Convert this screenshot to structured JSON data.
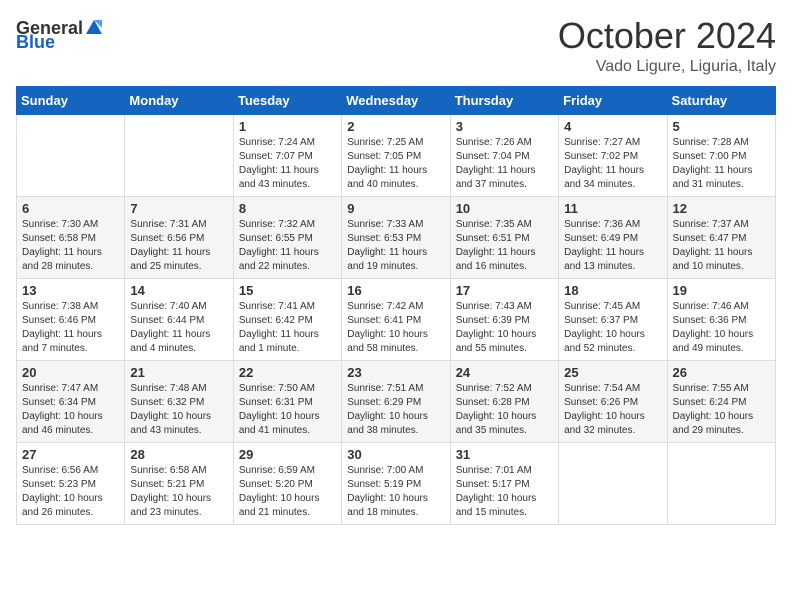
{
  "header": {
    "logo_general": "General",
    "logo_blue": "Blue",
    "month": "October 2024",
    "location": "Vado Ligure, Liguria, Italy"
  },
  "days_of_week": [
    "Sunday",
    "Monday",
    "Tuesday",
    "Wednesday",
    "Thursday",
    "Friday",
    "Saturday"
  ],
  "weeks": [
    [
      null,
      null,
      {
        "day": 1,
        "sunrise": "7:24 AM",
        "sunset": "7:07 PM",
        "daylight": "11 hours and 43 minutes."
      },
      {
        "day": 2,
        "sunrise": "7:25 AM",
        "sunset": "7:05 PM",
        "daylight": "11 hours and 40 minutes."
      },
      {
        "day": 3,
        "sunrise": "7:26 AM",
        "sunset": "7:04 PM",
        "daylight": "11 hours and 37 minutes."
      },
      {
        "day": 4,
        "sunrise": "7:27 AM",
        "sunset": "7:02 PM",
        "daylight": "11 hours and 34 minutes."
      },
      {
        "day": 5,
        "sunrise": "7:28 AM",
        "sunset": "7:00 PM",
        "daylight": "11 hours and 31 minutes."
      }
    ],
    [
      {
        "day": 6,
        "sunrise": "7:30 AM",
        "sunset": "6:58 PM",
        "daylight": "11 hours and 28 minutes."
      },
      {
        "day": 7,
        "sunrise": "7:31 AM",
        "sunset": "6:56 PM",
        "daylight": "11 hours and 25 minutes."
      },
      {
        "day": 8,
        "sunrise": "7:32 AM",
        "sunset": "6:55 PM",
        "daylight": "11 hours and 22 minutes."
      },
      {
        "day": 9,
        "sunrise": "7:33 AM",
        "sunset": "6:53 PM",
        "daylight": "11 hours and 19 minutes."
      },
      {
        "day": 10,
        "sunrise": "7:35 AM",
        "sunset": "6:51 PM",
        "daylight": "11 hours and 16 minutes."
      },
      {
        "day": 11,
        "sunrise": "7:36 AM",
        "sunset": "6:49 PM",
        "daylight": "11 hours and 13 minutes."
      },
      {
        "day": 12,
        "sunrise": "7:37 AM",
        "sunset": "6:47 PM",
        "daylight": "11 hours and 10 minutes."
      }
    ],
    [
      {
        "day": 13,
        "sunrise": "7:38 AM",
        "sunset": "6:46 PM",
        "daylight": "11 hours and 7 minutes."
      },
      {
        "day": 14,
        "sunrise": "7:40 AM",
        "sunset": "6:44 PM",
        "daylight": "11 hours and 4 minutes."
      },
      {
        "day": 15,
        "sunrise": "7:41 AM",
        "sunset": "6:42 PM",
        "daylight": "11 hours and 1 minute."
      },
      {
        "day": 16,
        "sunrise": "7:42 AM",
        "sunset": "6:41 PM",
        "daylight": "10 hours and 58 minutes."
      },
      {
        "day": 17,
        "sunrise": "7:43 AM",
        "sunset": "6:39 PM",
        "daylight": "10 hours and 55 minutes."
      },
      {
        "day": 18,
        "sunrise": "7:45 AM",
        "sunset": "6:37 PM",
        "daylight": "10 hours and 52 minutes."
      },
      {
        "day": 19,
        "sunrise": "7:46 AM",
        "sunset": "6:36 PM",
        "daylight": "10 hours and 49 minutes."
      }
    ],
    [
      {
        "day": 20,
        "sunrise": "7:47 AM",
        "sunset": "6:34 PM",
        "daylight": "10 hours and 46 minutes."
      },
      {
        "day": 21,
        "sunrise": "7:48 AM",
        "sunset": "6:32 PM",
        "daylight": "10 hours and 43 minutes."
      },
      {
        "day": 22,
        "sunrise": "7:50 AM",
        "sunset": "6:31 PM",
        "daylight": "10 hours and 41 minutes."
      },
      {
        "day": 23,
        "sunrise": "7:51 AM",
        "sunset": "6:29 PM",
        "daylight": "10 hours and 38 minutes."
      },
      {
        "day": 24,
        "sunrise": "7:52 AM",
        "sunset": "6:28 PM",
        "daylight": "10 hours and 35 minutes."
      },
      {
        "day": 25,
        "sunrise": "7:54 AM",
        "sunset": "6:26 PM",
        "daylight": "10 hours and 32 minutes."
      },
      {
        "day": 26,
        "sunrise": "7:55 AM",
        "sunset": "6:24 PM",
        "daylight": "10 hours and 29 minutes."
      }
    ],
    [
      {
        "day": 27,
        "sunrise": "6:56 AM",
        "sunset": "5:23 PM",
        "daylight": "10 hours and 26 minutes."
      },
      {
        "day": 28,
        "sunrise": "6:58 AM",
        "sunset": "5:21 PM",
        "daylight": "10 hours and 23 minutes."
      },
      {
        "day": 29,
        "sunrise": "6:59 AM",
        "sunset": "5:20 PM",
        "daylight": "10 hours and 21 minutes."
      },
      {
        "day": 30,
        "sunrise": "7:00 AM",
        "sunset": "5:19 PM",
        "daylight": "10 hours and 18 minutes."
      },
      {
        "day": 31,
        "sunrise": "7:01 AM",
        "sunset": "5:17 PM",
        "daylight": "10 hours and 15 minutes."
      },
      null,
      null
    ]
  ]
}
